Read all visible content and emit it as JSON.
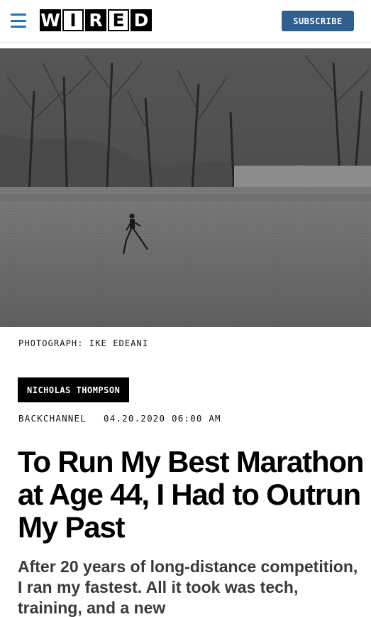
{
  "header": {
    "menu_icon": "hamburger-menu-icon",
    "logo_letters": [
      "W",
      "I",
      "R",
      "E",
      "D"
    ],
    "subscribe_label": "SUBSCRIBE",
    "colors": {
      "menu": "#1e73be",
      "subscribe_bg": "#2f5f8f"
    }
  },
  "hero": {
    "credit": "PHOTOGRAPH: IKE EDEANI"
  },
  "article": {
    "author": "NICHOLAS THOMPSON",
    "section": "BACKCHANNEL",
    "datetime": "04.20.2020 06:00 AM",
    "headline": "To Run My Best Marathon at Age 44, I Had to Outrun My Past",
    "dek": "After 20 years of long-distance competition, I ran my fastest. All it took was tech, training, and a new"
  }
}
